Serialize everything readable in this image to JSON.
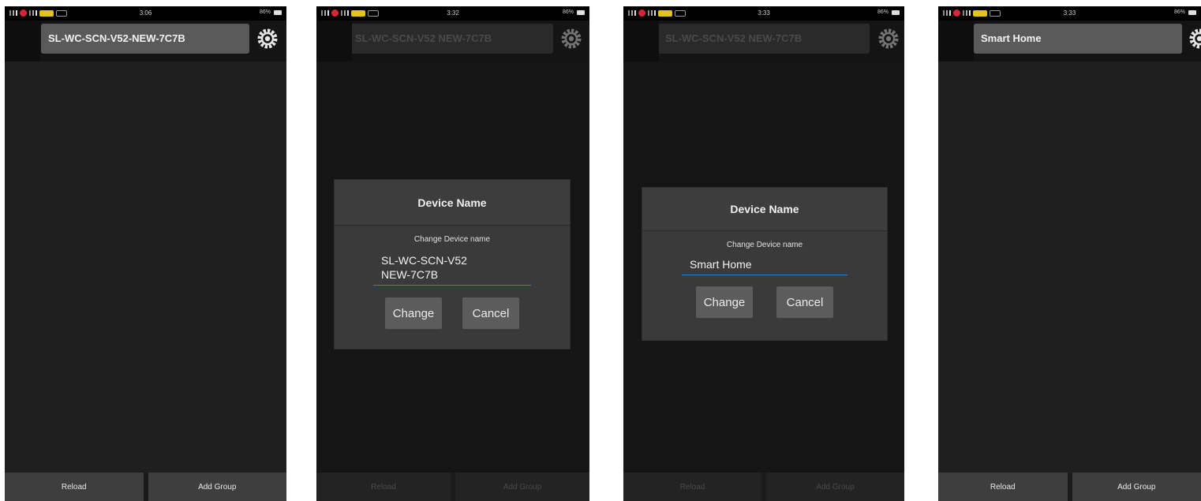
{
  "screens": [
    {
      "status": {
        "time": "3:06",
        "battery": "86%"
      },
      "title": "SL-WC-SCN-V52-NEW-7C7B",
      "bottom": {
        "reload": "Reload",
        "add_group": "Add Group"
      }
    },
    {
      "status": {
        "time": "3:32",
        "battery": "86%"
      },
      "title": "SL-WC-SCN-V52 NEW-7C7B",
      "dialog": {
        "heading": "Device Name",
        "subtitle": "Change Device name",
        "input_value": "SL-WC-SCN-V52\nNEW-7C7B",
        "change": "Change",
        "cancel": "Cancel"
      },
      "bottom": {
        "reload": "Reload",
        "add_group": "Add Group"
      }
    },
    {
      "status": {
        "time": "3:33",
        "battery": "86%"
      },
      "title": "SL-WC-SCN-V52 NEW-7C7B",
      "dialog": {
        "heading": "Device Name",
        "subtitle": "Change Device name",
        "input_value": "Smart Home",
        "change": "Change",
        "cancel": "Cancel"
      },
      "bottom": {
        "reload": "Reload",
        "add_group": "Add Group"
      }
    },
    {
      "status": {
        "time": "3:33",
        "battery": "86%"
      },
      "title": "Smart Home",
      "bottom": {
        "reload": "Reload",
        "add_group": "Add Group"
      }
    }
  ],
  "icons": {
    "settings": "gear-icon",
    "record": "record-dot-icon",
    "battery": "battery-icon"
  },
  "colors": {
    "dialog_underline": "#2b7ed1",
    "record_dot": "#d8253a",
    "badge": "#e4c21c"
  }
}
